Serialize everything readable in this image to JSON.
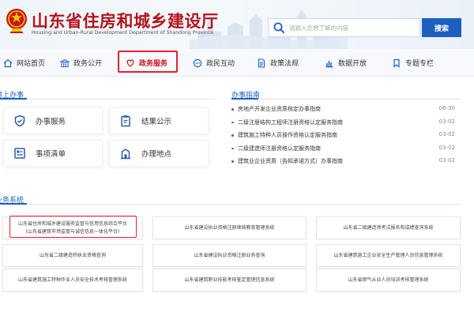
{
  "header": {
    "title": "山东省住房和城乡建设厅",
    "subtitle": "Housing and Urban-Rural Development Department of Shandong Province",
    "search_placeholder": "请输入您想了解的内容",
    "search_button": "搜索"
  },
  "nav": {
    "items": [
      {
        "label": "网站首页",
        "icon": "home-icon"
      },
      {
        "label": "政务公开",
        "icon": "bank-icon"
      },
      {
        "label": "政务服务",
        "icon": "heart-hands-icon",
        "active": true
      },
      {
        "label": "政民互动",
        "icon": "chat-icon"
      },
      {
        "label": "政策法规",
        "icon": "document-icon"
      },
      {
        "label": "数据开放",
        "icon": "chart-icon"
      },
      {
        "label": "专题专栏",
        "icon": "bookmark-icon"
      }
    ]
  },
  "online": {
    "title": "网上办事",
    "cards": [
      {
        "label": "办事服务",
        "icon": "shield-icon"
      },
      {
        "label": "结果公示",
        "icon": "clipboard-icon"
      },
      {
        "label": "事项清单",
        "icon": "list-icon"
      },
      {
        "label": "办理地点",
        "icon": "building-icon"
      }
    ]
  },
  "guide": {
    "title": "办事指南",
    "items": [
      {
        "text": "房地产开发企业资质核定办事指南",
        "date": "06-30"
      },
      {
        "text": "二级注册结构工程师注册资格认定服务指南",
        "date": "03-02"
      },
      {
        "text": "建筑施工特种人员操作资格认定服务指南",
        "date": "03-02"
      },
      {
        "text": "二级建造师注册资格认定服务指南",
        "date": "03-02"
      },
      {
        "text": "建筑业企业资质（告知承诺方式）办事指南",
        "date": "03-02"
      }
    ]
  },
  "systems": {
    "title": "业务系统",
    "items": [
      {
        "line1": "山东省住房和城乡建设服务监管与信用信息综合平台",
        "line2": "(山东省建筑市场监管与诚信信息一体化平台)"
      },
      {
        "line1": "山东省建设执业资格注册继续教育管理系统",
        "line2": ""
      },
      {
        "line1": "山东省二级建造师考试报名和成绩查询系统",
        "line2": ""
      },
      {
        "line1": "山东省二级建造师执业资格查询",
        "line2": ""
      },
      {
        "line1": "山东省建设执业资格注册业务查询",
        "line2": ""
      },
      {
        "line1": "山东省建筑施工企业安全生产管理人员信息管理系统",
        "line2": ""
      },
      {
        "line1": "山东省建筑施工特种作业人员安全技术考核管理系统",
        "line2": ""
      },
      {
        "line1": "山东省建筑职业技能考核鉴定管理信息系统",
        "line2": ""
      },
      {
        "line1": "山东省燃气从业人员培训考核管理系统",
        "line2": ""
      }
    ]
  },
  "colors": {
    "brand_red": "#b3141b",
    "accent_blue": "#1d5fbf",
    "highlight_red": "#e3232a"
  }
}
